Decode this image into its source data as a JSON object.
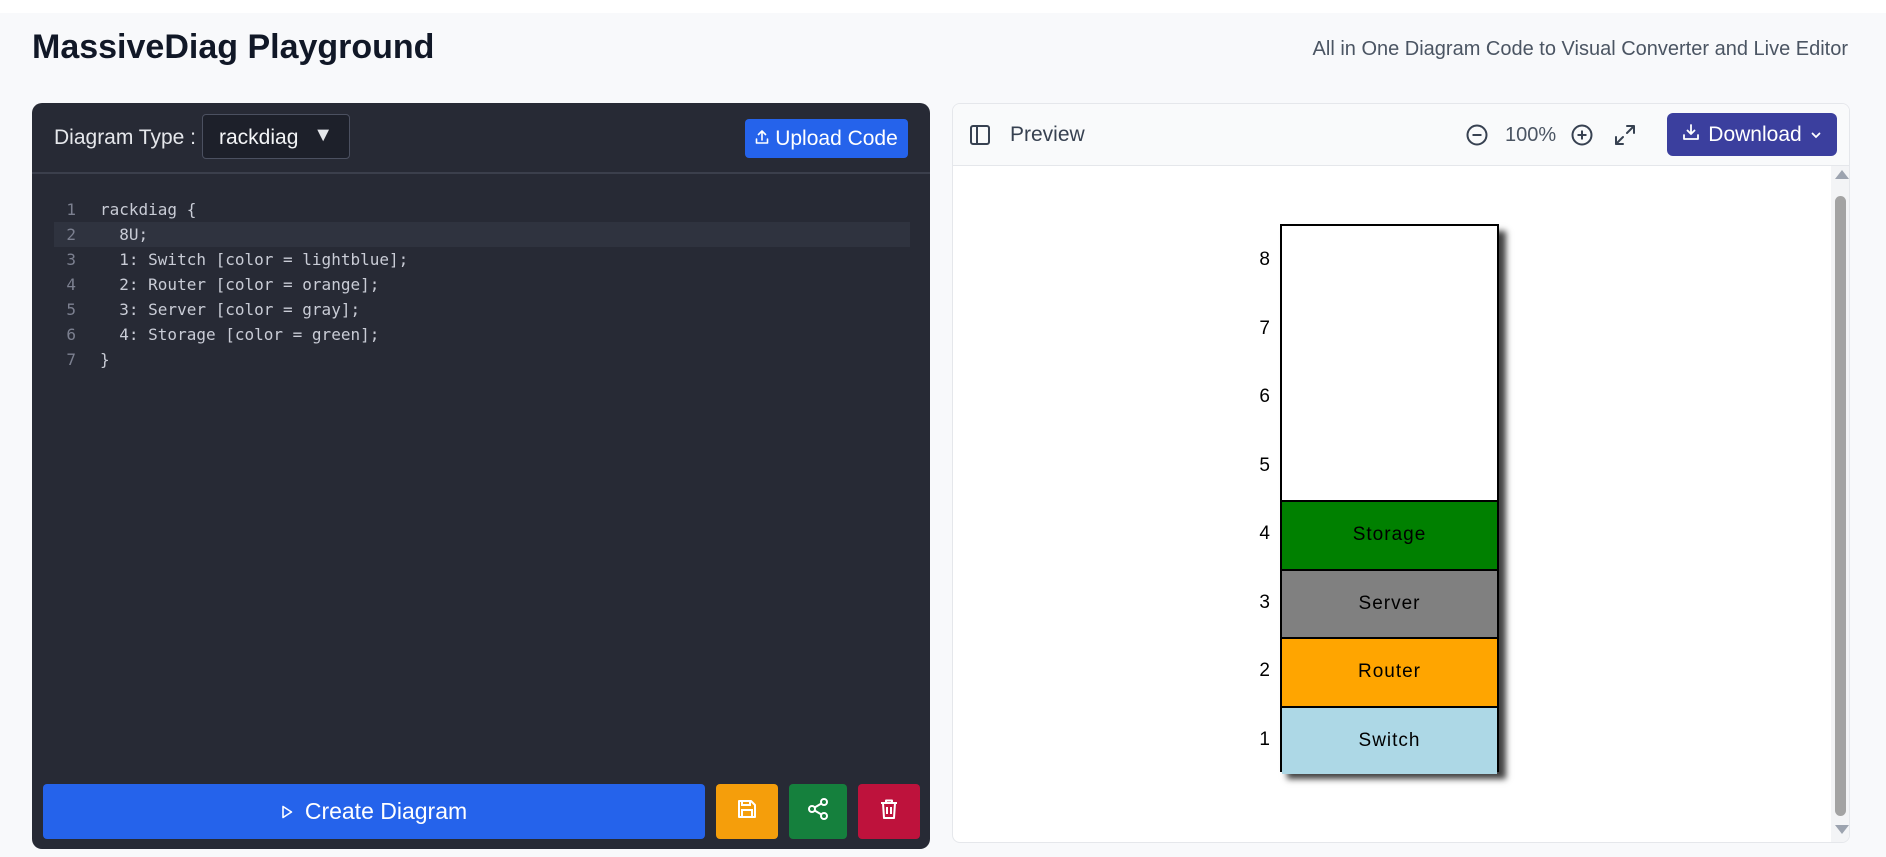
{
  "app": {
    "title": "MassiveDiag Playground",
    "subtitle": "All in One Diagram Code to Visual Converter and Live Editor"
  },
  "editor": {
    "diagram_type_label": "Diagram Type :",
    "diagram_type_value": "rackdiag",
    "upload_label": "Upload Code",
    "code_lines": [
      "rackdiag {",
      "  8U;",
      "  1: Switch [color = lightblue];",
      "  2: Router [color = orange];",
      "  3: Server [color = gray];",
      "  4: Storage [color = green];",
      "}"
    ],
    "active_line": 2,
    "create_label": "Create Diagram"
  },
  "preview": {
    "title": "Preview",
    "zoom": "100%",
    "download_label": "Download",
    "rack": {
      "units_total": 8,
      "unit_numbers": [
        "8",
        "7",
        "6",
        "5",
        "4",
        "3",
        "2",
        "1"
      ],
      "items": [
        {
          "unit": 1,
          "label": "Switch",
          "color": "#add8e6"
        },
        {
          "unit": 2,
          "label": "Router",
          "color": "#ffa500"
        },
        {
          "unit": 3,
          "label": "Server",
          "color": "#808080"
        },
        {
          "unit": 4,
          "label": "Storage",
          "color": "#008000"
        }
      ]
    }
  },
  "colors": {
    "primary": "#2563eb",
    "save": "#f59e0b",
    "share": "#15803d",
    "delete": "#be123c",
    "download": "#3b3f9e",
    "editor_bg": "#272a35"
  }
}
